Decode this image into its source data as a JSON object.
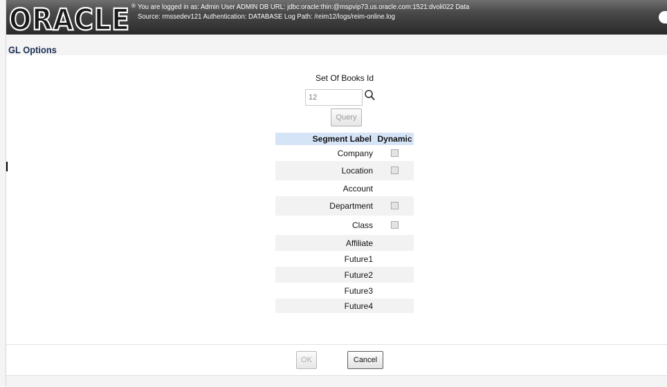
{
  "header": {
    "logo_text": "ORACLE",
    "info_line1": "You are logged in as: Admin User ADMIN  DB URL: jdbc:oracle:thin:@mspvip73.us.oracle.com:1521:dvoli022 Data",
    "info_line2": "Source: rmssedev121 Authentication: DATABASE Log Path: /reim12/logs/reim-online.log"
  },
  "page": {
    "title": "GL Options"
  },
  "set_of_books": {
    "label": "Set Of Books Id",
    "value": "12",
    "search_icon": "magnifier-icon",
    "query_label": "Query"
  },
  "segments_table": {
    "headers": {
      "label": "Segment Label",
      "dynamic": "Dynamic"
    },
    "rows": [
      {
        "label": "Company",
        "has_checkbox": true,
        "checked": false
      },
      {
        "label": "Location",
        "has_checkbox": true,
        "checked": false
      },
      {
        "label": "Account",
        "has_checkbox": false
      },
      {
        "label": "Department",
        "has_checkbox": true,
        "checked": false
      },
      {
        "label": "Class",
        "has_checkbox": true,
        "checked": false
      },
      {
        "label": "Affiliate",
        "has_checkbox": false
      },
      {
        "label": "Future1",
        "has_checkbox": false
      },
      {
        "label": "Future2",
        "has_checkbox": false
      },
      {
        "label": "Future3",
        "has_checkbox": false
      },
      {
        "label": "Future4",
        "has_checkbox": false
      }
    ]
  },
  "footer": {
    "ok_label": "OK",
    "cancel_label": "Cancel"
  },
  "colors": {
    "title_text": "#1b2e55",
    "table_header_bg": "#d6e4f7",
    "header_bg": "#3a3a3a"
  }
}
